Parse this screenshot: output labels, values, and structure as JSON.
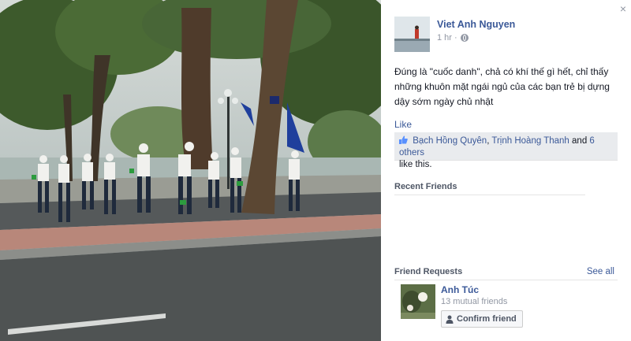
{
  "photo": {
    "alt_icon": "street-photo"
  },
  "panel": {
    "close_label": "×",
    "author": {
      "name": "Viet Anh Nguyen",
      "time": "1 hr ·"
    },
    "caption": "Đúng là \"cuốc danh\", chả có khí thế gì hết, chỉ thấy những khuôn mặt ngái ngủ của các bạn trẻ bị dựng dậy sớm ngày chủ nhật",
    "like_label": "Like",
    "likes": {
      "person1": "Bạch Hồng Quyên",
      "sep1": ", ",
      "person2": "Trịnh Hoàng Thanh",
      "and": " and ",
      "others": "6 others",
      "suffix": "like this."
    },
    "recent_friends_title": "Recent Friends",
    "friend_requests_title": "Friend Requests",
    "see_all": "See all",
    "request": {
      "name": "Anh Túc",
      "mutual": "13 mutual friends",
      "confirm": "Confirm friend"
    },
    "colors": {
      "link": "#3b5998",
      "muted": "#9197a3",
      "likes_bg": "#e9ebee"
    }
  }
}
